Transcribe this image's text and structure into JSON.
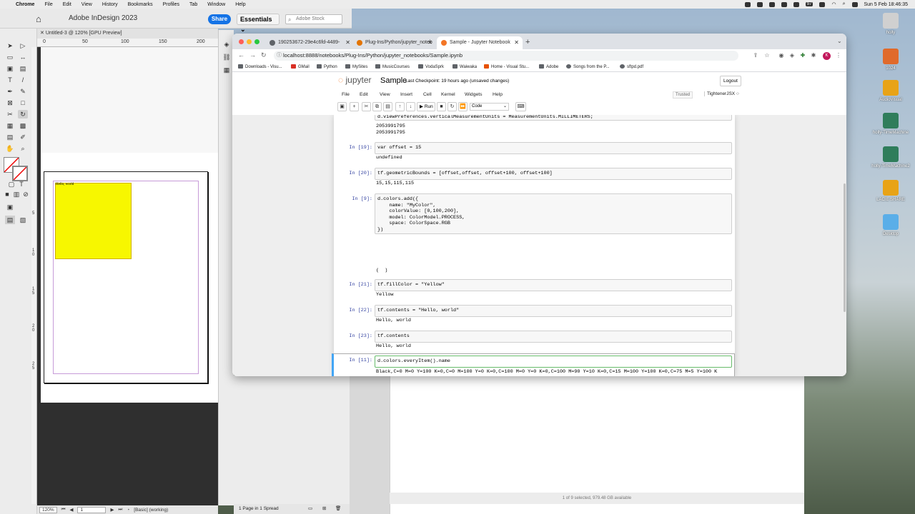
{
  "menubar": {
    "app": "Chrome",
    "items": [
      "File",
      "Edit",
      "View",
      "History",
      "Bookmarks",
      "Profiles",
      "Tab",
      "Window",
      "Help"
    ],
    "battery": "97",
    "datetime": "Sun 5 Feb  18:46:35"
  },
  "indesign": {
    "app_title": "Adobe InDesign 2023",
    "share_label": "Share",
    "workspace": "Essentials",
    "stock_placeholder": "Adobe Stock",
    "doc_tab": "Untitled-3 @ 120% [GPU Preview]",
    "ruler_h": [
      "0",
      "50",
      "100",
      "150",
      "200"
    ],
    "ruler_v": [
      "5",
      "10",
      "15",
      "20",
      "25"
    ],
    "frame_text": "Hello, world",
    "zoom": "120%",
    "page_num": "1",
    "style": "[Basic] (working)",
    "pages_footer": "1 Page in 1 Spread"
  },
  "finder": {
    "footer": "1 of 9 selected, 979.48 GB available"
  },
  "chrome": {
    "tabs": [
      {
        "title": "190253672-29e4c6fd-4489-",
        "fav_color": "#5f6368"
      },
      {
        "title": "Plug-Ins/Python/jupyter_noteb",
        "fav_color": "#e37400"
      },
      {
        "title": "Sample - Jupyter Notebook",
        "fav_color": "#f37626"
      }
    ],
    "url": "localhost:8888/notebooks/Plug-Ins/Python/jupyter_notebooks/Sample.ipynb",
    "avatar_letter": "K",
    "bookmarks": [
      "Downloads - Visu...",
      "GMail",
      "Python",
      "MySites",
      "MusicCourses",
      "VodaSprk",
      "Waiwaka",
      "Home - Visual Stu...",
      "Adobe",
      "Songs from the P...",
      "sftpd.pdf"
    ]
  },
  "jupyter": {
    "logo_text": "jupyter",
    "notebook_name": "Sample",
    "checkpoint": "Last Checkpoint: 19 hours ago",
    "unsaved": "(unsaved changes)",
    "logout": "Logout",
    "menu": [
      "File",
      "Edit",
      "View",
      "Insert",
      "Cell",
      "Kernel",
      "Widgets",
      "Help"
    ],
    "trusted": "Trusted",
    "kernel": "TightenerJSX",
    "run_label": "Run",
    "cell_type": "Code",
    "cells": [
      {
        "prompt": "",
        "code": "d.viewPreferences.verticalMeasurementUnits = MeasurementUnits.MILLIMETERS;",
        "output": "2053991795\n2053991795"
      },
      {
        "prompt": "In [19]:",
        "code": "var offset = 15",
        "output": "undefined"
      },
      {
        "prompt": "In [20]:",
        "code": "tf.geometricBounds = [offset,offset, offset+100, offset+100]",
        "output": "15,15,115,115"
      },
      {
        "prompt": "In [9]:",
        "code": "d.colors.add({\n    name: \"MyColor\",\n    colorValue: [0,100,200],\n    model: ColorModel.PROCESS,\n    space: ColorSpace.RGB\n})",
        "output": "(  )"
      },
      {
        "prompt": "In [21]:",
        "code": "tf.fillColor = \"Yellow\"",
        "output": "Yellow"
      },
      {
        "prompt": "In [22]:",
        "code": "tf.contents = \"Hello, world\"",
        "output": "Hello, world"
      },
      {
        "prompt": "In [23]:",
        "code": "tf.contents",
        "output": "Hello, world"
      },
      {
        "prompt": "In [11]:",
        "code": "d.colors.everyItem().name",
        "output": "Black,C=0 M=0 Y=100 K=0,C=0 M=100 Y=0 K=0,C=100 M=0 Y=0 K=0,C=100 M=90 Y=10 K=0,C=15 M=100 Y=100 K=0,C=75 M=5 Y=100 K"
      }
    ]
  },
  "desktop": {
    "icons": [
      {
        "label": "holly",
        "color": "#d0d0d0"
      },
      {
        "label": "1024",
        "color": "#e06a2b"
      },
      {
        "label": "AudioVisual",
        "color": "#e8a317"
      },
      {
        "label": "holly-TimeMachine",
        "color": "#2f7d5b"
      },
      {
        "label": "holly-TimeMachine2",
        "color": "#2f7d5b"
      },
      {
        "label": "LACIE SHARE",
        "color": "#e8a317"
      },
      {
        "label": "Desktop",
        "color": "#5aaee8"
      }
    ]
  }
}
